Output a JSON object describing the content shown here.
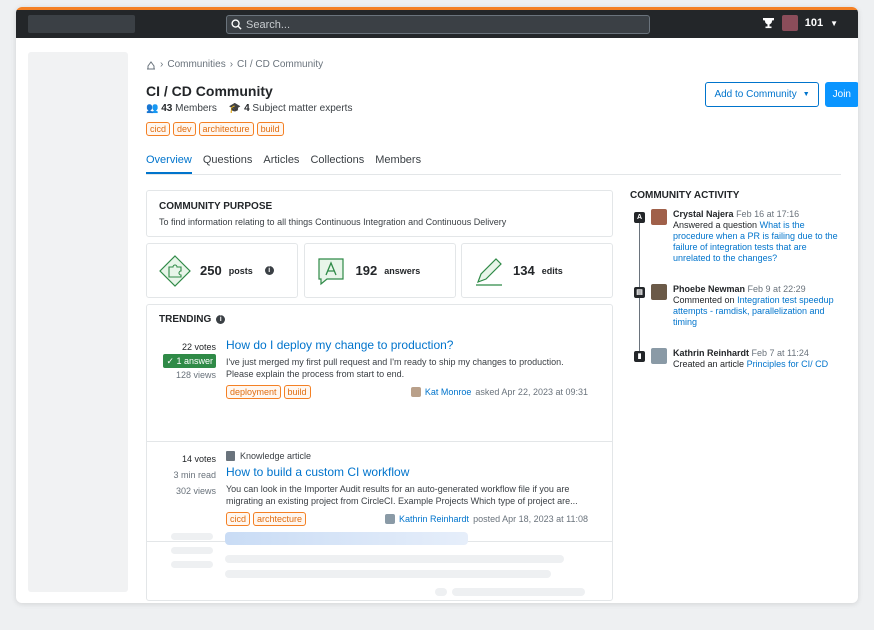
{
  "header": {
    "search_placeholder": "Search...",
    "reputation": "101"
  },
  "breadcrumb": {
    "items": [
      "Communities",
      "CI / CD Community"
    ],
    "separator": "›"
  },
  "community": {
    "title": "CI / CD Community",
    "members_count": "43",
    "members_label": "Members",
    "experts_count": "4",
    "experts_label": "Subject matter experts",
    "tags": [
      "cicd",
      "dev",
      "architecture",
      "build"
    ]
  },
  "actions": {
    "add_to_community": "Add to Community",
    "join": "Join"
  },
  "tabs": [
    {
      "label": "Overview",
      "active": true
    },
    {
      "label": "Questions",
      "active": false
    },
    {
      "label": "Articles",
      "active": false
    },
    {
      "label": "Collections",
      "active": false
    },
    {
      "label": "Members",
      "active": false
    }
  ],
  "purpose": {
    "heading": "COMMUNITY PURPOSE",
    "text": "To find information relating to all things Continuous Integration and Continuous Delivery"
  },
  "stats": [
    {
      "icon": "puzzle-icon",
      "value": "250",
      "label": "posts"
    },
    {
      "icon": "answer-icon",
      "value": "192",
      "label": "answers"
    },
    {
      "icon": "pencil-icon",
      "value": "134",
      "label": "edits"
    }
  ],
  "trending": {
    "heading": "TRENDING",
    "items": [
      {
        "votes": "22 votes",
        "answers": "✓ 1 answer",
        "views": "128 views",
        "title": "How do I deploy my change to production?",
        "excerpt": "I've just merged my first pull request and I'm ready to ship my changes to production. Please explain the process from start to end.",
        "tags": [
          "deployment",
          "build"
        ],
        "author": "Kat Monroe",
        "when": "asked Apr 22, 2023 at 09:31"
      },
      {
        "votes": "14 votes",
        "read_time": "3 min read",
        "views": "302 views",
        "type_label": "Knowledge article",
        "title": "How to build a custom CI workflow",
        "excerpt": "You can look in the Importer Audit results for an auto-generated workflow file if you are migrating an existing project from CircleCI. Example Projects Which type of project are...",
        "tags": [
          "cicd",
          "archtecture"
        ],
        "author": "Kathrin Reinhardt",
        "when": "posted Apr 18, 2023 at 11:08"
      }
    ]
  },
  "activity": {
    "heading": "COMMUNITY ACTIVITY",
    "items": [
      {
        "badge": "A",
        "who": "Crystal Najera",
        "when": "Feb 16 at 17:16",
        "action": "Answered a question",
        "link": "What is the procedure when a PR is failing due to the failure of integration tests that are unrelated to the changes?",
        "avatar_color": "#a0604a"
      },
      {
        "badge": "▤",
        "who": "Phoebe Newman",
        "when": "Feb 9 at 22:29",
        "action": "Commented on",
        "link": "Integration test speedup attempts - ramdisk, parallelization and timing",
        "avatar_color": "#6b5a48"
      },
      {
        "badge": "▮",
        "who": "Kathrin Reinhardt",
        "when": "Feb 7 at 11:24",
        "action": "Created an article",
        "link": "Principles for CI/ CD",
        "avatar_color": "#8a9aa6"
      }
    ]
  }
}
